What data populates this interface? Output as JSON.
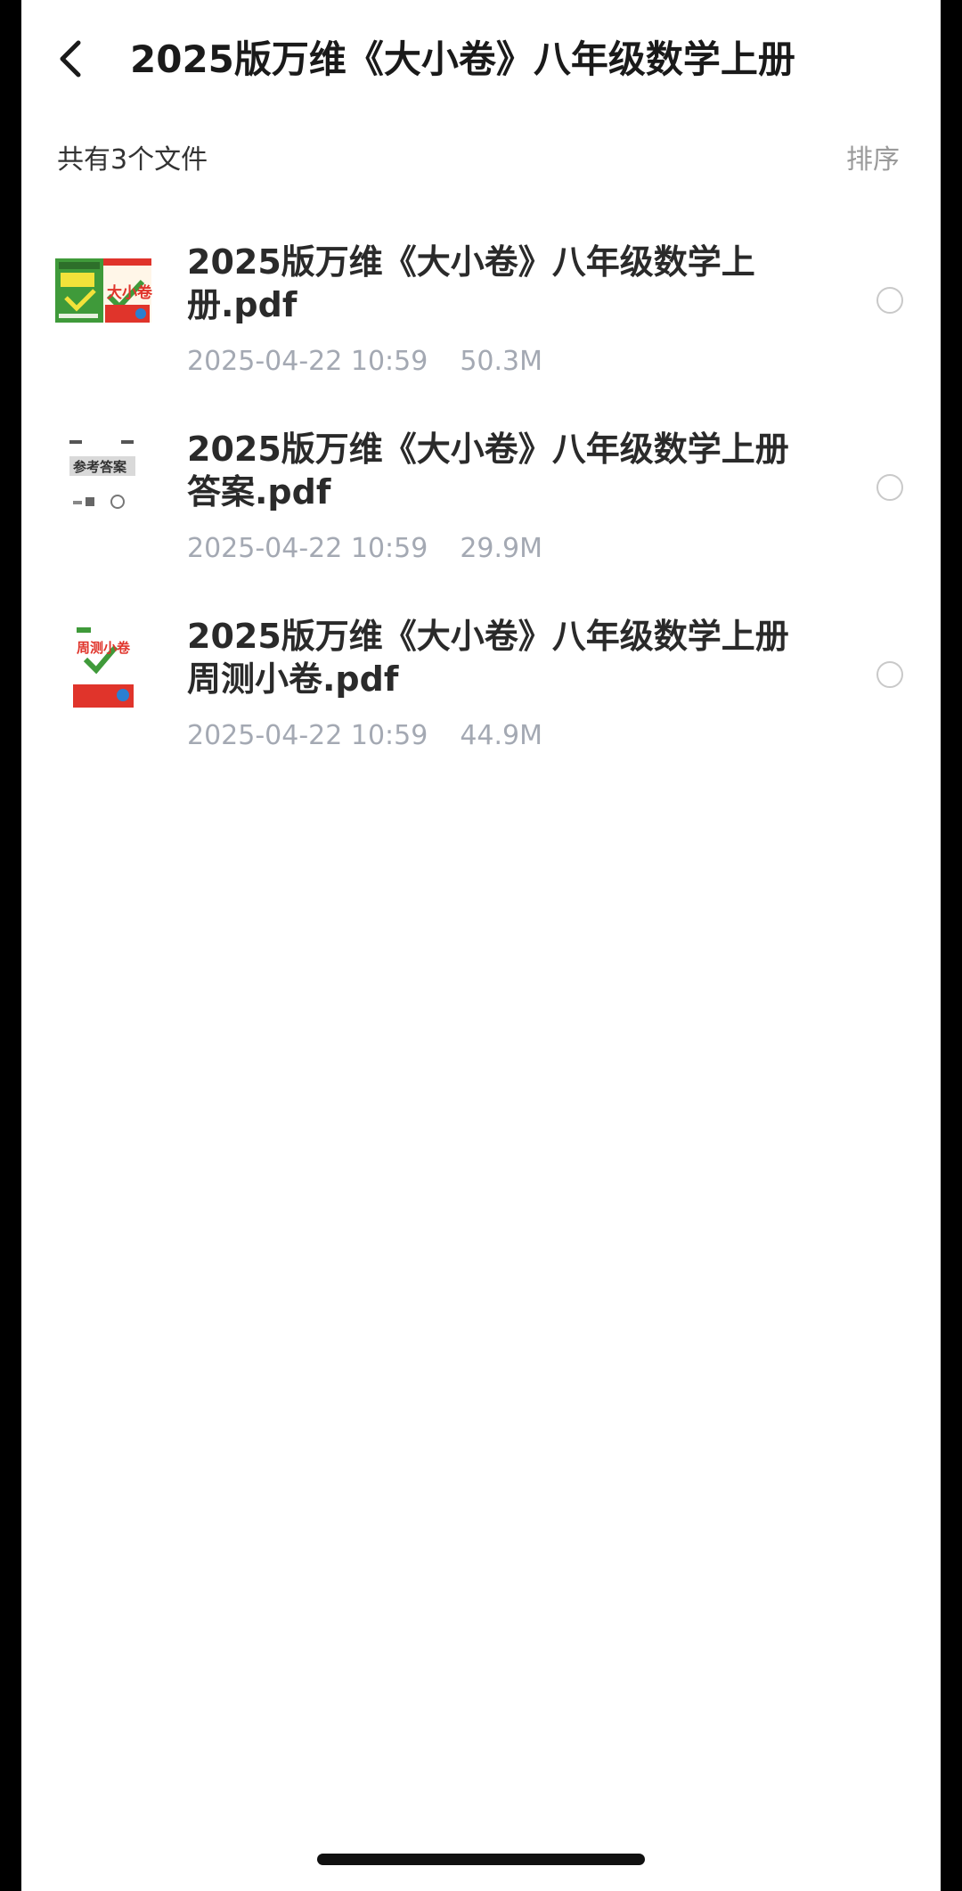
{
  "header": {
    "title": "2025版万维《大小卷》八年级数学上册",
    "back_icon": "chevron-left-icon"
  },
  "list_header": {
    "count_text": "共有3个文件",
    "sort_label": "排序"
  },
  "files": [
    {
      "name": "2025版万维《大小卷》八年级数学上册.pdf",
      "date": "2025-04-22 10:59",
      "size": "50.3M",
      "thumbnail": "book-cover-thumbnail",
      "thumb_text": "大小卷"
    },
    {
      "name": "2025版万维《大小卷》八年级数学上册答案.pdf",
      "date": "2025-04-22 10:59",
      "size": "29.9M",
      "thumbnail": "answer-sheet-thumbnail",
      "thumb_text": "参考答案"
    },
    {
      "name": "2025版万维《大小卷》八年级数学上册周测小卷.pdf",
      "date": "2025-04-22 10:59",
      "size": "44.9M",
      "thumbnail": "weekly-test-thumbnail",
      "thumb_text": "周测小卷"
    }
  ],
  "colors": {
    "background": "#ffffff",
    "title_text": "#1a1a1a",
    "meta_text": "#a4a9b3",
    "sort_text": "#9a9a9a",
    "radio_border": "#c9c9c9",
    "cover_green": "#3f9a3a",
    "cover_red": "#e0342b",
    "cover_yellow": "#f2e23a"
  }
}
